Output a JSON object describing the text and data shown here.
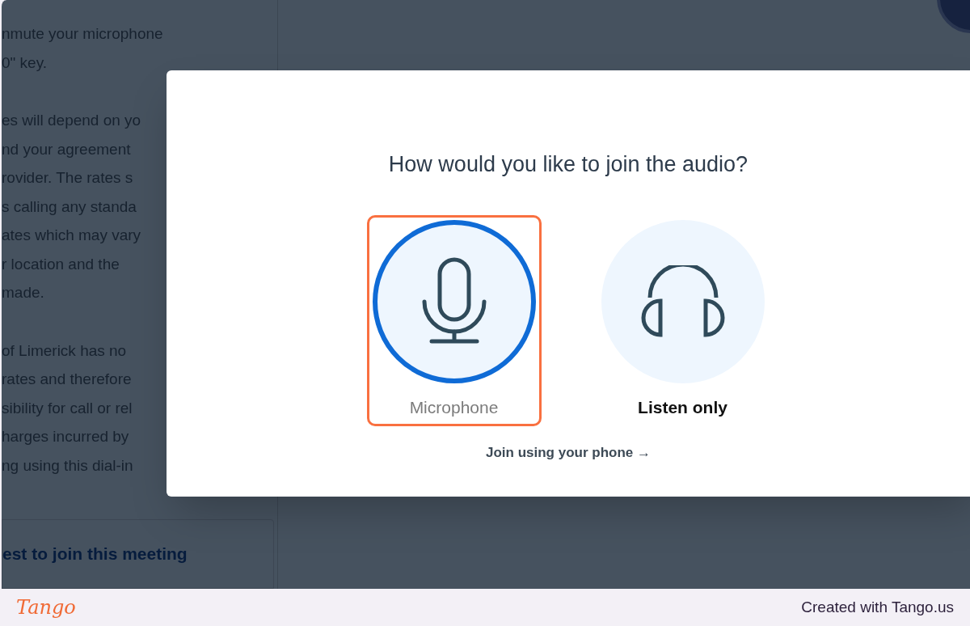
{
  "background": {
    "paragraphs": [
      [
        "nmute your microphone",
        "0\" key."
      ],
      [
        "es will depend on yo",
        "nd your agreement",
        "rovider. The rates s",
        "s calling any standa",
        "ates which may vary",
        "r location and the",
        "made."
      ],
      [
        "of Limerick has no",
        "rates and therefore",
        "sibility for call or rel",
        "harges incurred by",
        "ng using this dial-in"
      ]
    ],
    "request_link": "est to join this meeting"
  },
  "dialog": {
    "title": "How would you like to join the audio?",
    "options": [
      {
        "kind": "microphone",
        "label": "Microphone",
        "selected": true
      },
      {
        "kind": "headphones",
        "label": "Listen only",
        "selected": false
      }
    ],
    "phone_link": "Join using your phone →"
  },
  "footer": {
    "logo": "Tango",
    "credit": "Created with Tango.us"
  }
}
